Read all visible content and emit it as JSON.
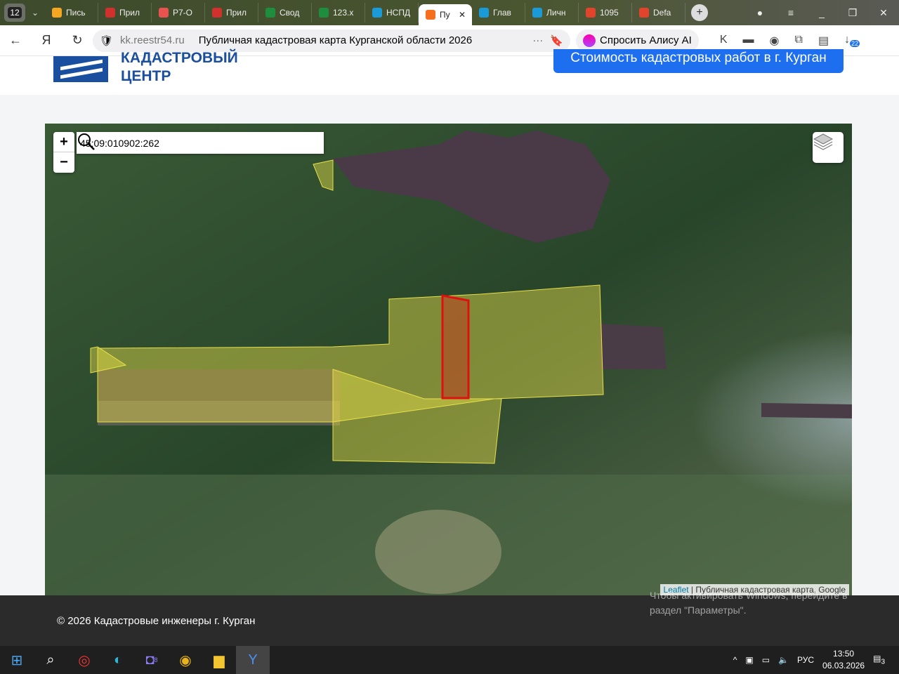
{
  "browser": {
    "tab_count": "12",
    "tabs": [
      {
        "label": "Пись",
        "color": "#f5a623"
      },
      {
        "label": "Прил",
        "color": "#d0312d"
      },
      {
        "label": "Р7-О",
        "color": "#e8534f"
      },
      {
        "label": "Прил",
        "color": "#d0312d"
      },
      {
        "label": "Свод",
        "color": "#1e8e3e"
      },
      {
        "label": "123.x",
        "color": "#1e8e3e"
      },
      {
        "label": "НСПД",
        "color": "#1a9ad6"
      },
      {
        "label": "Пу",
        "color": "#f56f1f",
        "active": true
      },
      {
        "label": "Глав",
        "color": "#1a9ad6"
      },
      {
        "label": "Личн",
        "color": "#1a9ad6"
      },
      {
        "label": "1095",
        "color": "#e0452b"
      },
      {
        "label": "Defa",
        "color": "#e0452b"
      }
    ],
    "url_host": "kk.reestr54.ru",
    "page_title": "Публичная кадастровая карта Курганской области 2026",
    "alice_label": "Спросить Алису AI",
    "downloads_badge": "22"
  },
  "header": {
    "brand_line1": "КАДАСТРОВЫЙ",
    "brand_line2": "ЦЕНТР",
    "cta": "Стоимость кадастровых работ в г. Курган"
  },
  "map": {
    "zoom_in": "+",
    "zoom_out": "−",
    "search_value": "45:09:010902:262",
    "attribution_link": "Leaflet",
    "attribution_text": " | Публичная кадастровая карта, Google",
    "selected_color": "#e01010",
    "parcel_color": "#e8e04a"
  },
  "footer": {
    "copyright": "© 2026 Кадастровые инженеры г. Курган"
  },
  "watermark": {
    "line1": "Чтобы активировать Windows, перейдите в",
    "line2": "раздел \"Параметры\"."
  },
  "taskbar": {
    "lang": "РУС",
    "time": "13:50",
    "date": "06.03.2026",
    "notif": "3",
    "messenger_badge": "8"
  }
}
